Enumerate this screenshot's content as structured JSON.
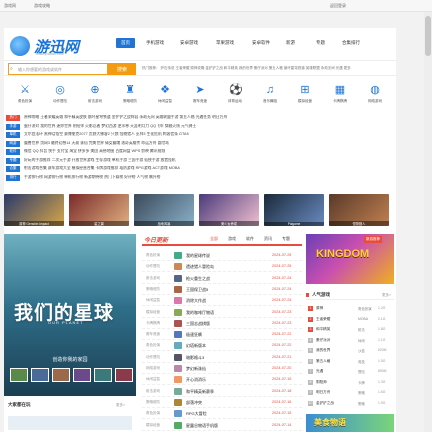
{
  "browser": {
    "tab1": "游戏网",
    "tab2": "游戏攻略",
    "tab3": "返回登录"
  },
  "site": {
    "logo_text": "游迅网",
    "logo_sub": "www.yxdown.com",
    "nav": [
      "首页",
      "手机游戏",
      "安卓游戏",
      "苹果游戏",
      "安卓软件",
      "新游",
      "专题",
      "合集排行"
    ],
    "nav_active_index": 0
  },
  "search": {
    "placeholder": "输入你想要的游戏或软件",
    "button": "搜索",
    "hotwords": "热门推荐：  炉石传说  王者荣耀  原神攻略  金铲铲之战  和平精英  我的世界  蛋仔派对  第五人格  崩坏星穹铁道  英雄联盟  永劫无间  光遇  更多"
  },
  "categories": [
    {
      "label": "角色扮演",
      "icon": "sword-icon",
      "glyph": "⚔"
    },
    {
      "label": "动作冒险",
      "icon": "target-icon",
      "glyph": "◎"
    },
    {
      "label": "射击游戏",
      "icon": "crosshair-icon",
      "glyph": "⊕"
    },
    {
      "label": "策略塔防",
      "icon": "tower-icon",
      "glyph": "♜"
    },
    {
      "label": "休闲益智",
      "icon": "puzzle-icon",
      "glyph": "❖"
    },
    {
      "label": "赛车竞速",
      "icon": "car-icon",
      "glyph": "➤"
    },
    {
      "label": "体育运动",
      "icon": "ball-icon",
      "glyph": "⚽"
    },
    {
      "label": "音乐舞蹈",
      "icon": "music-icon",
      "glyph": "♫"
    },
    {
      "label": "模拟经营",
      "icon": "gamepad-icon",
      "glyph": "⊞"
    },
    {
      "label": "卡牌棋牌",
      "icon": "cards-icon",
      "glyph": "▦"
    },
    {
      "label": "网络游戏",
      "icon": "globe-icon",
      "glyph": "◍"
    }
  ],
  "link_rows": [
    {
      "tag": "热门",
      "red": true,
      "text": "原神攻略  王者荣耀英雄  和平精英皮肤  崩坏星穹铁道  金铲铲之战阵容  永劫无间  英雄联盟手游  第五人格  光遇任务  明日方舟"
    },
    {
      "tag": "手游",
      "red": false,
      "text": "蛋仔派对  我的世界  迷你世界  阴阳师  火影忍者  梦幻西游  逆水寒  天涯明月刀  QQ飞车  穿越火线  元气骑士"
    },
    {
      "tag": "单机",
      "red": false,
      "text": "艾尔登法环  黑神话悟空  赛博朋克2077  荒野大镖客2  只狼  怪物猎人  巫师3  生化危机  刺客信条  GTA5"
    },
    {
      "tag": "网游",
      "red": false,
      "text": "魔兽世界  剑网3  最终幻想14  天谕  诛仙  完美世界  倩女幽魂  洛奇英雄传  命运方舟  冒险岛"
    },
    {
      "tag": "软件",
      "red": false,
      "text": "微信  QQ  抖音  快手  支付宝  淘宝  拼多多  美团  高德地图  百度网盘  WPS  剪映  腾讯视频"
    },
    {
      "tag": "专题",
      "red": false,
      "text": "好玩的手游推荐  二次元手游  开放世界游戏  生存游戏  单机手游  三国手游  仙侠手游  放置挂机"
    },
    {
      "tag": "合集",
      "red": false,
      "text": "射击游戏合集  赛车游戏大全  模拟经营合集  卡牌游戏推荐  塔防游戏  RPG游戏  ACT游戏  MOBA"
    },
    {
      "tag": "排行",
      "red": false,
      "text": "手游排行榜  网游排行榜  单机排行榜  新游期待榜  热门下载榜  好评榜  人气榜  飙升榜"
    }
  ],
  "banners": [
    {
      "label": "原神 Genshin Impact",
      "c1": "#2a3a6a",
      "c2": "#d6a64a"
    },
    {
      "label": "星之翼",
      "c1": "#7a2a2a",
      "c2": "#e0b080"
    },
    {
      "label": "战地风暴",
      "c1": "#3a4a5a",
      "c2": "#8ab0c8"
    },
    {
      "label": "美少女养成",
      "c1": "#4a3a7a",
      "c2": "#f0c0d0"
    },
    {
      "label": "Palgame",
      "c1": "#1a2a3a",
      "c2": "#6a8ac0"
    },
    {
      "label": "怪物猎人",
      "c1": "#5a3a2a",
      "c2": "#c08050"
    }
  ],
  "hero": {
    "title": "我们的星球",
    "subtitle": "OUR PLANET",
    "caption": "创造你我的家园"
  },
  "hero_bottom": {
    "title": "大家都在玩",
    "more": "更多>"
  },
  "news": {
    "title": "今日更新",
    "tabs": [
      "全部",
      "游戏",
      "软件",
      "资讯",
      "专题"
    ],
    "active_tab": 0,
    "rows": [
      {
        "cat": "角色扮演",
        "title": "我的星球传说",
        "date": "2024-07-25",
        "color": "#4a8"
      },
      {
        "cat": "动作冒险",
        "title": "遗迹猎人冒险岛",
        "date": "2024-07-25",
        "color": "#c85"
      },
      {
        "cat": "射击游戏",
        "title": "枪火重生之战",
        "date": "2024-07-24",
        "color": "#568"
      },
      {
        "cat": "策略塔防",
        "title": "王国保卫战5",
        "date": "2024-07-24",
        "color": "#a64"
      },
      {
        "cat": "休闲益智",
        "title": "消除大作战",
        "date": "2024-07-24",
        "color": "#d7a"
      },
      {
        "cat": "模拟经营",
        "title": "我的咖啡厅物语",
        "date": "2024-07-23",
        "color": "#8a5"
      },
      {
        "cat": "卡牌棋牌",
        "title": "三国志战棋版",
        "date": "2024-07-23",
        "color": "#a55"
      },
      {
        "cat": "赛车竞速",
        "title": "极速狂飙",
        "date": "2024-07-22",
        "color": "#57b"
      },
      {
        "cat": "角色扮演",
        "title": "幻塔新版本",
        "date": "2024-07-22",
        "color": "#6ab"
      },
      {
        "cat": "动作冒险",
        "title": "暗影格斗3",
        "date": "2024-07-21",
        "color": "#556"
      },
      {
        "cat": "网络游戏",
        "title": "梦幻新诛仙",
        "date": "2024-07-20",
        "color": "#b8a"
      },
      {
        "cat": "休闲益智",
        "title": "开心消消乐",
        "date": "2024-07-19",
        "color": "#e96"
      },
      {
        "cat": "射击游戏",
        "title": "和平精英新赛季",
        "date": "2024-07-18",
        "color": "#7a9"
      },
      {
        "cat": "策略塔防",
        "title": "部落冲突",
        "date": "2024-07-16",
        "color": "#a83"
      },
      {
        "cat": "角色扮演",
        "title": "RPG大冒险",
        "date": "2024-07-15",
        "color": "#69c"
      },
      {
        "cat": "模拟经营",
        "title": "星露谷物语手机版",
        "date": "2024-07-14",
        "color": "#5a6"
      }
    ]
  },
  "right_banner": {
    "text": "KINGDOM",
    "badge": "新游推荐"
  },
  "ranking": {
    "title": "人气游戏",
    "more": "更多>",
    "rows": [
      {
        "n": "1",
        "title": "原神",
        "cat": "角色扮演",
        "size": "1.2G"
      },
      {
        "n": "2",
        "title": "王者荣耀",
        "cat": "MOBA",
        "size": "2.1G"
      },
      {
        "n": "3",
        "title": "和平精英",
        "cat": "射击",
        "size": "1.8G"
      },
      {
        "n": "4",
        "title": "蛋仔派对",
        "cat": "休闲",
        "size": "1.1G"
      },
      {
        "n": "5",
        "title": "我的世界",
        "cat": "沙盒",
        "size": "620M"
      },
      {
        "n": "6",
        "title": "第五人格",
        "cat": "竞技",
        "size": "1.5G"
      },
      {
        "n": "7",
        "title": "光遇",
        "cat": "冒险",
        "size": "890M"
      },
      {
        "n": "8",
        "title": "阴阳师",
        "cat": "卡牌",
        "size": "1.3G"
      },
      {
        "n": "9",
        "title": "明日方舟",
        "cat": "策略",
        "size": "1.6G"
      },
      {
        "n": "10",
        "title": "金铲铲之战",
        "cat": "策略",
        "size": "1.9G"
      }
    ]
  },
  "right_banner2": {
    "text": "美食物语"
  }
}
